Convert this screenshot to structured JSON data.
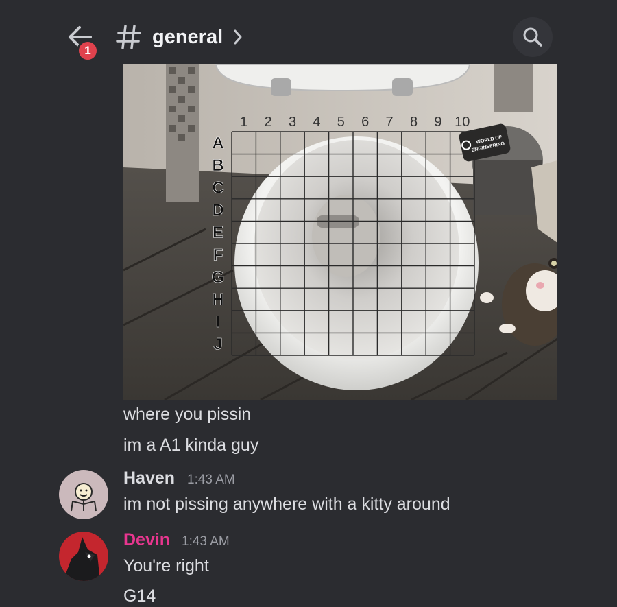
{
  "header": {
    "channel_name": "general",
    "unread_badge": "1",
    "back_icon": "back-arrow-icon",
    "channel_icon": "hash-icon",
    "search_icon": "search-icon"
  },
  "attachment": {
    "row_labels": [
      "A",
      "B",
      "C",
      "D",
      "E",
      "F",
      "G",
      "H",
      "I",
      "J"
    ],
    "col_labels": [
      "1",
      "2",
      "3",
      "4",
      "5",
      "6",
      "7",
      "8",
      "9",
      "10"
    ],
    "logo_text_line1": "WORLD OF",
    "logo_text_line2": "ENGINEERING"
  },
  "messages": [
    {
      "text": "where you pissin"
    },
    {
      "text": "im a A1 kinda guy"
    },
    {
      "author": "Haven",
      "time": "1:43 AM",
      "text": "im not pissing anywhere with a kitty around",
      "author_color": "#f2f3f5"
    },
    {
      "author": "Devin",
      "time": "1:43 AM",
      "text": "You're right",
      "author_color": "#e8368f"
    },
    {
      "text": "G14"
    }
  ]
}
